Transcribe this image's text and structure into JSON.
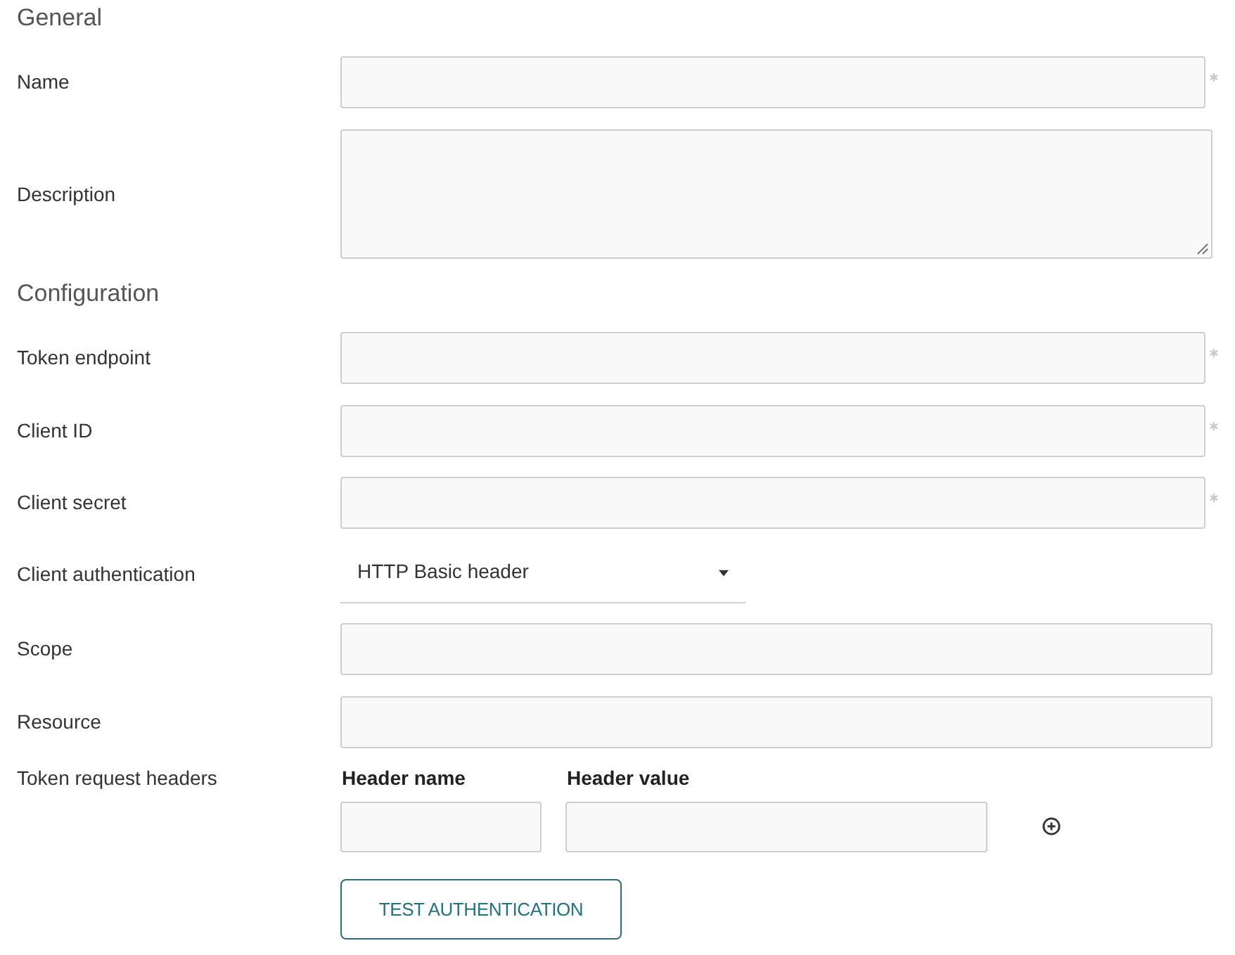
{
  "sections": [
    {
      "title": "General",
      "fields": [
        {
          "kind": "text",
          "label": "Name",
          "required": true
        },
        {
          "kind": "textarea",
          "label": "Description",
          "required": false
        }
      ]
    },
    {
      "title": "Configuration",
      "fields": [
        {
          "kind": "text",
          "label": "Token endpoint",
          "required": true
        },
        {
          "kind": "text",
          "label": "Client ID",
          "required": true
        },
        {
          "kind": "text",
          "label": "Client secret",
          "required": true
        },
        {
          "kind": "select",
          "label": "Client authentication",
          "value": "HTTP Basic header"
        },
        {
          "kind": "text",
          "label": "Scope",
          "required": false
        },
        {
          "kind": "text",
          "label": "Resource",
          "required": false
        },
        {
          "kind": "headers",
          "label": "Token request headers",
          "columns": [
            "Header name",
            "Header value"
          ]
        }
      ]
    }
  ],
  "button": {
    "label": "TEST AUTHENTICATION"
  }
}
